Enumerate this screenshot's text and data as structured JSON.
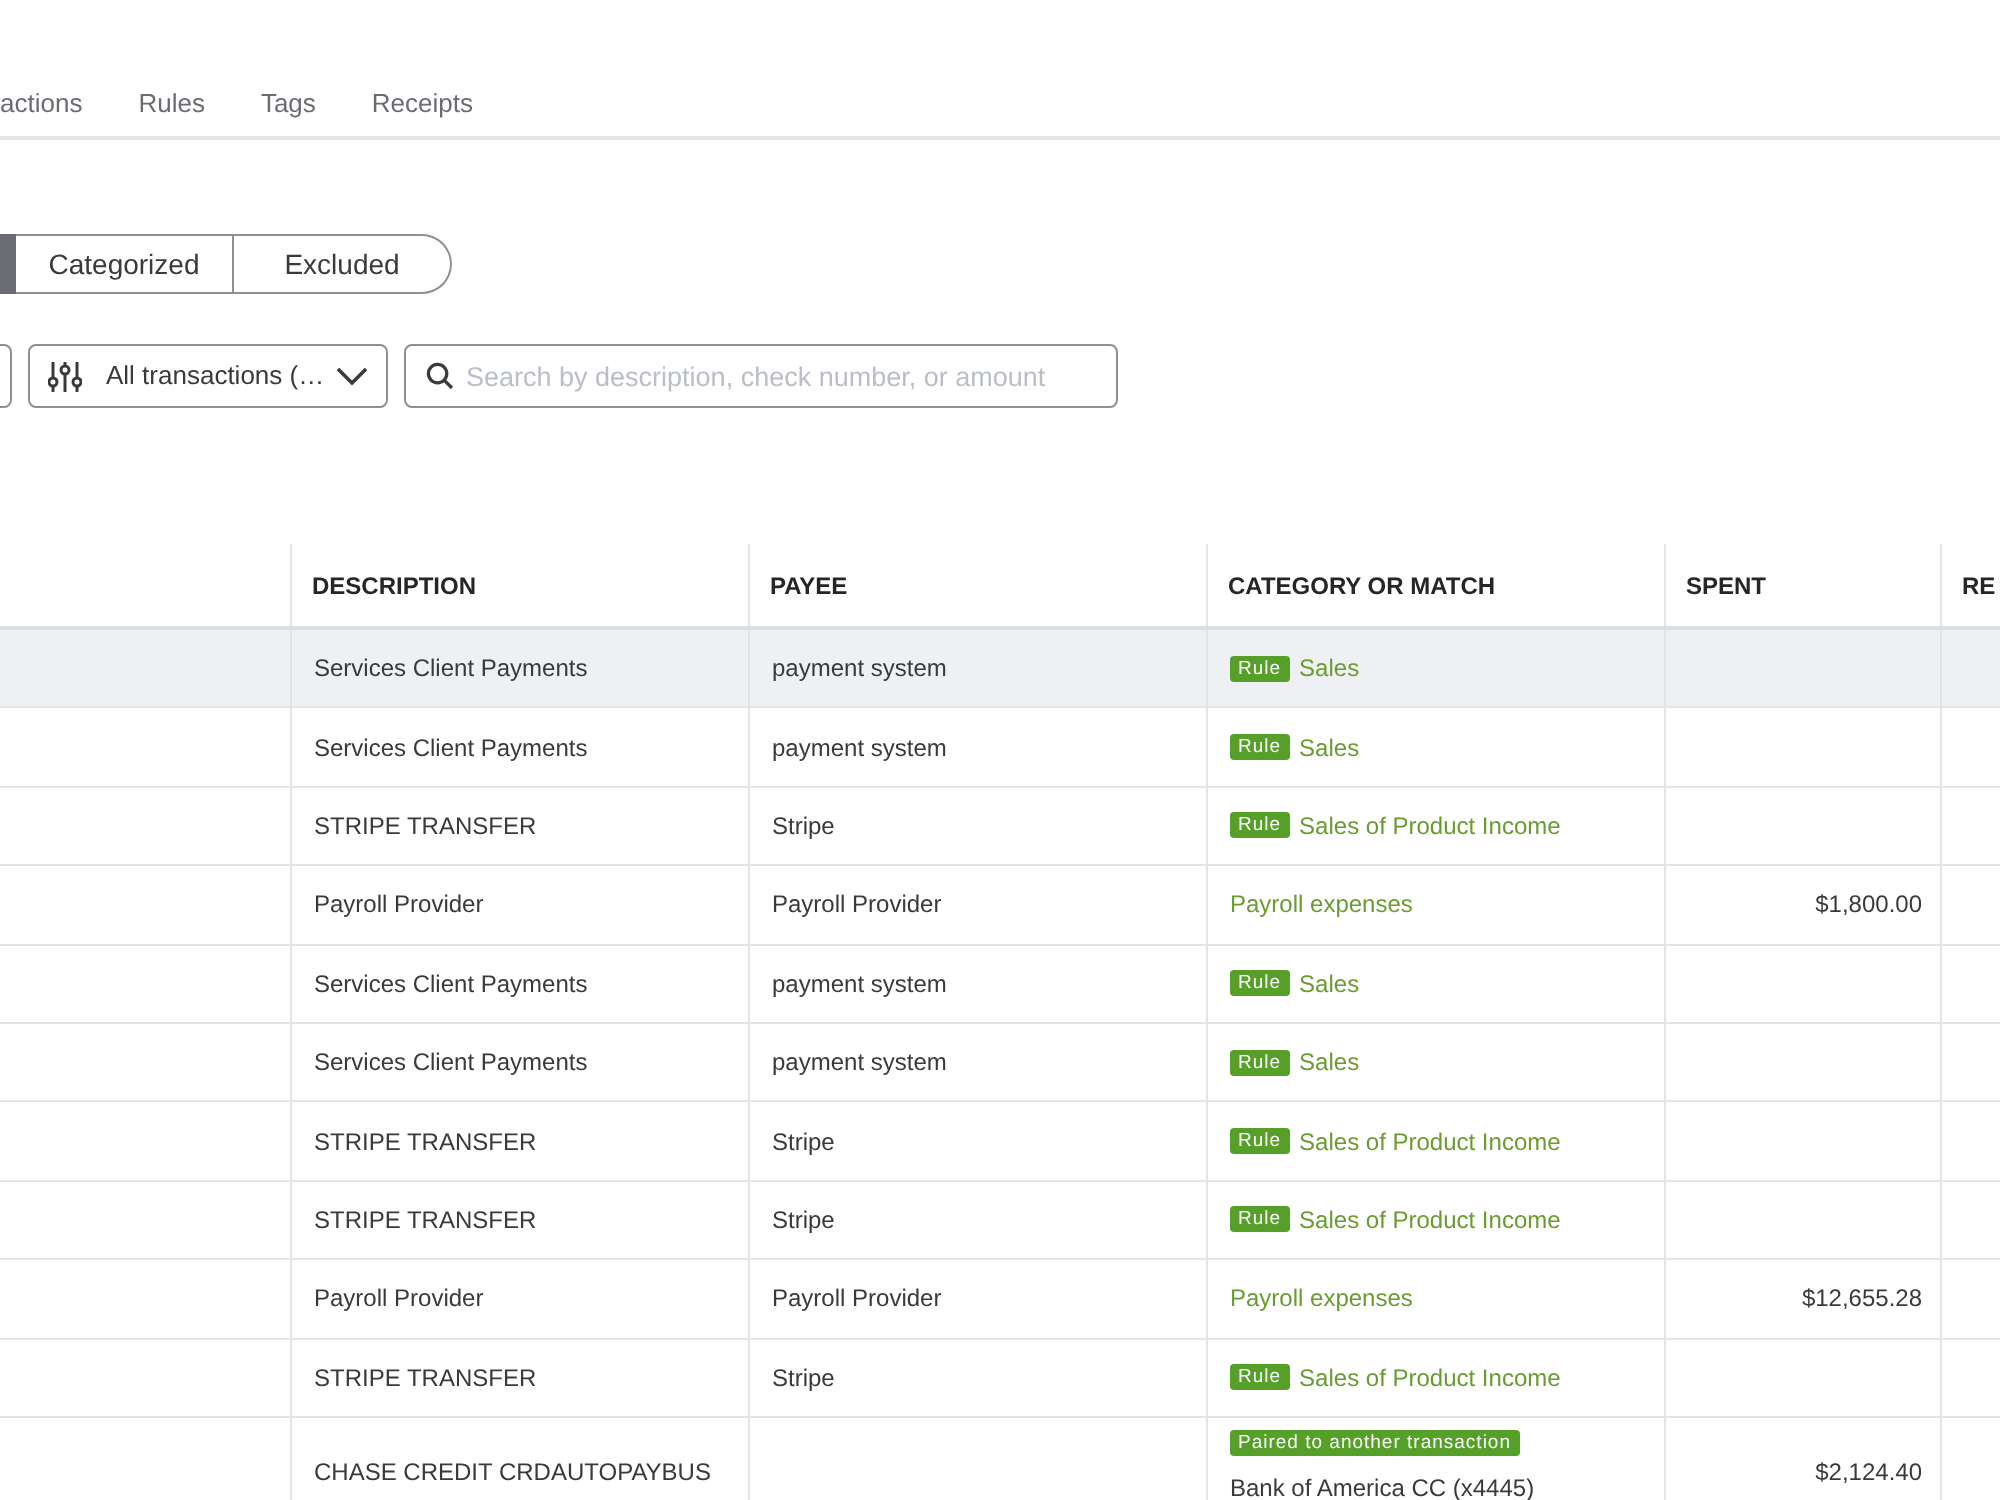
{
  "nav_tabs": [
    "actions",
    "Rules",
    "Tags",
    "Receipts"
  ],
  "status_tabs": [
    {
      "selected": true
    },
    {
      "label": "Categorized",
      "selected": false
    },
    {
      "label": "Excluded",
      "selected": false
    }
  ],
  "filter": {
    "value": "All transactions (…"
  },
  "search": {
    "placeholder": "Search by description, check number, or amount"
  },
  "table": {
    "columns": [
      "DESCRIPTION",
      "PAYEE",
      "CATEGORY OR MATCH",
      "SPENT",
      "RE"
    ],
    "rows": [
      {
        "highlighted": true,
        "description": "Services Client Payments",
        "payee": "payment system",
        "category": {
          "kind": "rule",
          "badge": "Rule",
          "text": "Sales"
        }
      },
      {
        "highlighted": false,
        "description": "Services Client Payments",
        "payee": "payment system",
        "category": {
          "kind": "rule",
          "badge": "Rule",
          "text": "Sales"
        }
      },
      {
        "highlighted": false,
        "description": "STRIPE TRANSFER",
        "payee": "Stripe",
        "category": {
          "kind": "rule",
          "badge": "Rule",
          "text": "Sales of Product Income"
        }
      },
      {
        "highlighted": false,
        "description": "Payroll Provider",
        "payee": "Payroll Provider",
        "category": {
          "kind": "category",
          "text": "Payroll expenses"
        },
        "spent": "$1,800.00"
      },
      {
        "highlighted": false,
        "description": "Services Client Payments",
        "payee": "payment system",
        "category": {
          "kind": "rule",
          "badge": "Rule",
          "text": "Sales"
        }
      },
      {
        "highlighted": false,
        "description": "Services Client Payments",
        "payee": "payment system",
        "category": {
          "kind": "rule",
          "badge": "Rule",
          "text": "Sales"
        }
      },
      {
        "highlighted": false,
        "description": "STRIPE TRANSFER",
        "payee": "Stripe",
        "category": {
          "kind": "rule",
          "badge": "Rule",
          "text": "Sales of Product Income"
        }
      },
      {
        "highlighted": false,
        "description": "STRIPE TRANSFER",
        "payee": "Stripe",
        "category": {
          "kind": "rule",
          "badge": "Rule",
          "text": "Sales of Product Income"
        }
      },
      {
        "highlighted": false,
        "description": "Payroll Provider",
        "payee": "Payroll Provider",
        "category": {
          "kind": "category",
          "text": "Payroll expenses"
        },
        "spent": "$12,655.28"
      },
      {
        "highlighted": false,
        "description": "STRIPE TRANSFER",
        "payee": "Stripe",
        "category": {
          "kind": "rule",
          "badge": "Rule",
          "text": "Sales of Product Income"
        }
      },
      {
        "highlighted": false,
        "description": "CHASE CREDIT CRDAUTOPAYBUS",
        "category": {
          "kind": "match",
          "badge": "Paired to another transaction",
          "text": "Bank of America CC (x4445)"
        },
        "spent": "$2,124.40"
      }
    ]
  }
}
